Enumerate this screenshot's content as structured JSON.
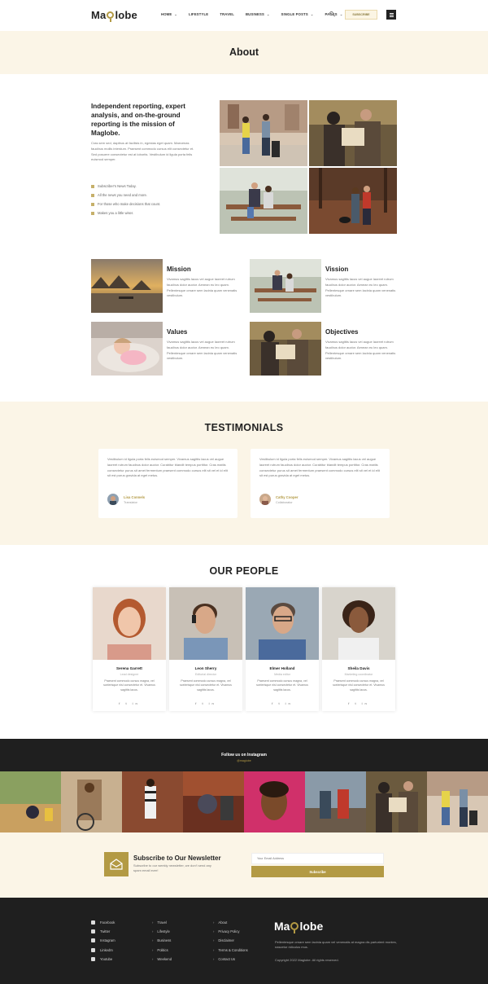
{
  "brand": {
    "logo_pre": "Ma",
    "logo_post": "lobe",
    "accent": "#b39a44"
  },
  "nav": {
    "items": [
      {
        "label": "HOME",
        "caret": true
      },
      {
        "label": "LIFESTYLE",
        "caret": false
      },
      {
        "label": "TRAVEL",
        "caret": false
      },
      {
        "label": "BUSINESS",
        "caret": true
      },
      {
        "label": "SINGLE POSTS",
        "caret": true
      },
      {
        "label": "PAGES",
        "caret": true
      }
    ],
    "subscribe_label": "SUBSCRIBE"
  },
  "page": {
    "title": "About"
  },
  "intro": {
    "title": "Independent reporting, expert analysis, and on-the-ground reporting is the mission of Maglobe.",
    "text": "Cras sem sed, dapibus at facilisis in, egestas eget quam. Maecenas faucibus mollis interdum. Praesent commodo cursus elit consectetur et. Sed posuere consectetur est at lobortis. Vestibulum id ligula porta felis euismod semper.",
    "checks": [
      "Subscriber's News Today.",
      "All the news you need and more.",
      "For those who make decisions that count.",
      "Makes you a little wiser."
    ]
  },
  "features": [
    {
      "title": "Mission",
      "text": "Vivamus sagittis lacus vel augue laoreet rutrum faucibus dolor auctor. Aenean eu leo quam. Pellentesque ornare sem lacinia quam venenatis vestibulum."
    },
    {
      "title": "Vission",
      "text": "Vivamus sagittis lacus vel augue laoreet rutrum faucibus dolor auctor. Aenean eu leo quam. Pellentesque ornare sem lacinia quam venenatis vestibulum."
    },
    {
      "title": "Values",
      "text": "Vivamus sagittis lacus vel augue laoreet rutrum faucibus dolor auctor. Aenean eu leo quam. Pellentesque ornare sem lacinia quam venenatis vestibulum."
    },
    {
      "title": "Objectives",
      "text": "Vivamus sagittis lacus vel augue laoreet rutrum faucibus dolor auctor. Aenean eu leo quam. Pellentesque ornare sem lacinia quam venenatis vestibulum."
    }
  ],
  "testimonials": {
    "heading": "TESTIMONIALS",
    "items": [
      {
        "quote": "Vestibulum id ligula porta felis euismod semper. Vivamus sagittis lacus vel augue laoreet rutrum faucibus dolor auctor. Curabitur blandit tempus porttitor. Cras mattis consectetur purus sit amet fermentum praesent commodo cursus elit sit vel et id elit sit est purus gravida at eget metus.",
        "name": "Lisa Connels",
        "role": "Translator"
      },
      {
        "quote": "Vestibulum id ligula porta felis euismod semper. Vivamus sagittis lacus vel augue laoreet rutrum faucibus dolor auctor. Curabitur blandit tempus porttitor. Cras mattis consectetur purus sit amet fermentum praesent commodo cursus elit sit vel et id elit sit est purus gravida at eget metus.",
        "name": "Cathy Cooper",
        "role": "Collaborator"
      }
    ]
  },
  "people": {
    "heading": "OUR PEOPLE",
    "items": [
      {
        "name": "Serena Garrett",
        "role": "Lead designer",
        "bio": "Praesent commodo cursus magna, vel scelerisque nisl consectetur et. Vivamus sagittis lacus."
      },
      {
        "name": "Leon Sherry",
        "role": "Editorial director",
        "bio": "Praesent commodo cursus magna, vel scelerisque nisl consectetur et. Vivamus sagittis lacus."
      },
      {
        "name": "Elmer Holland",
        "role": "Media editor",
        "bio": "Praesent commodo cursus magna, vel scelerisque nisl consectetur et. Vivamus sagittis lacus."
      },
      {
        "name": "Sheila Davis",
        "role": "Marketing coordinator",
        "bio": "Praesent commodo cursus magna, vel scelerisque nisl consectetur et. Vivamus sagittis lacus."
      }
    ],
    "social": "f  t  in"
  },
  "instagram": {
    "title": "Follow us on Instagram",
    "handle": "@maglobe"
  },
  "newsletter": {
    "title": "Subscribe to Our Newsletter",
    "text": "Subscribe to our weekly newsletter, we don't send any spam email ever!",
    "placeholder": "Your Email Address",
    "button": "Subscribe"
  },
  "footer": {
    "social": [
      "Facebook",
      "Twitter",
      "Instagram",
      "LinkedIn",
      "Youtube"
    ],
    "categories": [
      "Travel",
      "Lifestyle",
      "Business",
      "Politics",
      "Weekend"
    ],
    "pages": [
      "About",
      "Privacy Policy",
      "Disclaimer",
      "Terms & Conditions",
      "Contact Us"
    ],
    "description": "Pellentesque ornare sem lacinia quam vel venenatis at magna dis parturient montes, nascetur ridiculus mus.",
    "copyright": "Copyright 2022 Maglobe. All rights reserved."
  }
}
